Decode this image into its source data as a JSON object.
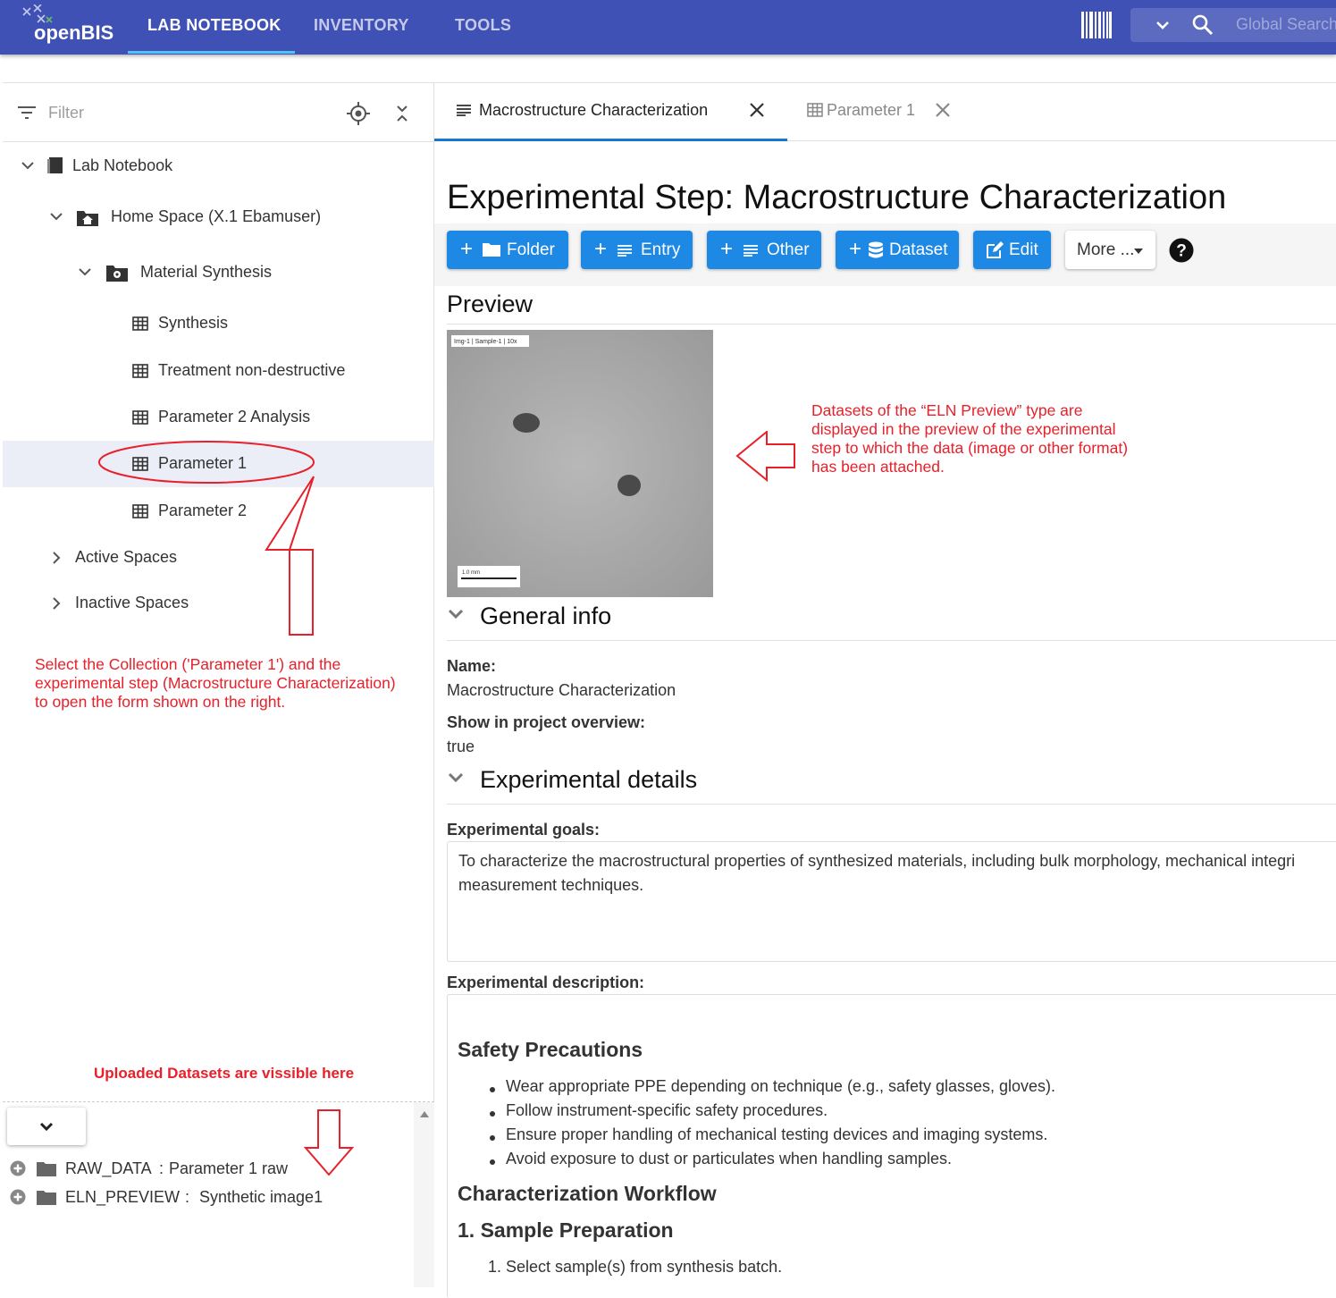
{
  "appbar": {
    "logo": "openBIS",
    "tabs": [
      "LAB NOTEBOOK",
      "INVENTORY",
      "TOOLS"
    ],
    "search_placeholder": "Global Search"
  },
  "sidebar": {
    "filter_placeholder": "Filter",
    "tree": {
      "lab_notebook": "Lab Notebook",
      "home_space": "Home Space (X.1 Ebamuser)",
      "material_synthesis": "Material Synthesis",
      "synthesis": "Synthesis",
      "treatment": "Treatment non-destructive",
      "param2_analysis": "Parameter 2 Analysis",
      "param1": "Parameter 1",
      "param2": "Parameter 2",
      "active_spaces": "Active Spaces",
      "inactive_spaces": "Inactive Spaces"
    },
    "annotation": [
      "Select the Collection ('Parameter 1') and the",
      "experimental step (Macrostructure Characterization)",
      "to open the form shown on the right."
    ],
    "datasets_note": "Uploaded Datasets are vissible here",
    "datasets": [
      {
        "type": "RAW_DATA",
        "name": "Parameter 1 raw"
      },
      {
        "type": "ELN_PREVIEW",
        "name": "Synthetic image1"
      }
    ]
  },
  "tabs": {
    "active": "Macrostructure Characterization",
    "second": "Parameter 1"
  },
  "main": {
    "title": "Experimental Step: Macrostructure Characterization",
    "buttons": {
      "folder": "Folder",
      "entry": "Entry",
      "other": "Other",
      "dataset": "Dataset",
      "edit": "Edit",
      "more": "More ..."
    },
    "preview_title": "Preview",
    "preview_image": {
      "label": "Img-1 | Sample-1 | 10x",
      "scale": "1.0 mm"
    },
    "preview_annotation": [
      "Datasets of the “ELN Preview” type are",
      "displayed in the preview of the experimental",
      "step to which the data (image or other format)",
      "has been attached."
    ],
    "general_info": {
      "title": "General info",
      "name_label": "Name:",
      "name_value": "Macrostructure Characterization",
      "show_label": "Show in project overview:",
      "show_value": "true"
    },
    "experimental_details": {
      "title": "Experimental details",
      "goals_label": "Experimental goals:",
      "goals_line1": "To characterize the macrostructural properties of synthesized materials, including bulk morphology, mechanical integri",
      "goals_line2": "measurement techniques.",
      "description_label": "Experimental description:",
      "safety_title": "Safety Precautions",
      "safety_items": [
        "Wear appropriate PPE depending on technique (e.g., safety glasses, gloves).",
        "Follow instrument-specific safety procedures.",
        "Ensure proper handling of mechanical testing devices and imaging systems.",
        "Avoid exposure to dust or particulates when handling samples."
      ],
      "workflow_title": "Characterization Workflow",
      "step1_title": "1. Sample Preparation",
      "step1_items": [
        "1. Select sample(s) from synthesis batch."
      ]
    }
  },
  "colors": {
    "appbar": "#3f51b5",
    "accent": "#1e88e5",
    "annotation": "#e8202a"
  }
}
